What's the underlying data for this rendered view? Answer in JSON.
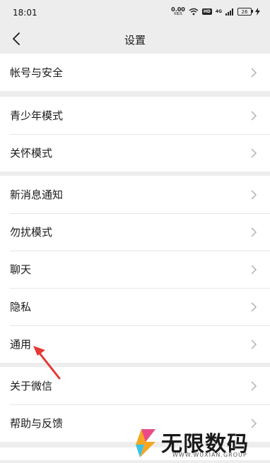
{
  "status_bar": {
    "time": "18:01",
    "net_speed": "0.00",
    "net_unit": "KB/S",
    "hd": "HD",
    "network": "4G",
    "battery": "26"
  },
  "nav": {
    "title": "设置",
    "back_icon": "chevron-left-icon"
  },
  "groups": [
    {
      "items": [
        {
          "label": "帐号与安全"
        }
      ]
    },
    {
      "items": [
        {
          "label": "青少年模式"
        },
        {
          "label": "关怀模式"
        }
      ]
    },
    {
      "items": [
        {
          "label": "新消息通知"
        },
        {
          "label": "勿扰模式"
        },
        {
          "label": "聊天"
        },
        {
          "label": "隐私"
        },
        {
          "label": "通用"
        }
      ]
    },
    {
      "items": [
        {
          "label": "关于微信"
        },
        {
          "label": "帮助与反馈"
        }
      ]
    }
  ],
  "annotation": {
    "color": "#e53935"
  },
  "watermark": {
    "brand": "无限数码",
    "url": "WWW.WUXIAN.GROUP"
  }
}
